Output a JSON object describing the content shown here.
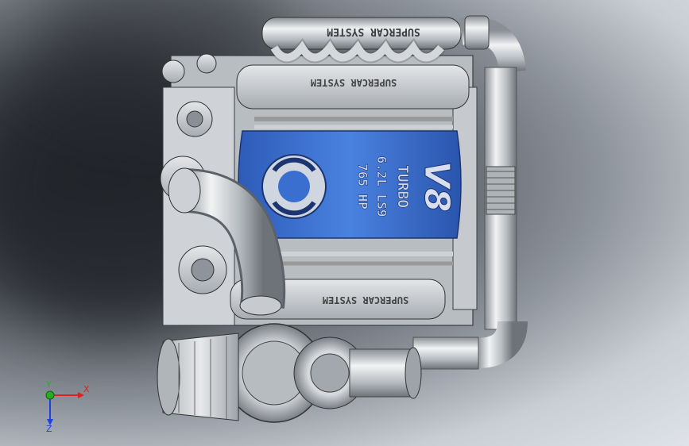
{
  "app": {
    "title": ""
  },
  "model": {
    "manifold_top_text": "SUPERCAR SYSTEM",
    "valve_cover_text": "SUPERCAR SYSTEM",
    "valve_cover_bottom_text": "SUPERCAR SYSTEM",
    "intake_line1": "TURBO",
    "intake_line2": "6.2L LS9",
    "intake_line3": "765 HP",
    "intake_badge": "V8"
  },
  "triad": {
    "x_label": "X",
    "y_label": "Y",
    "z_label": "Z"
  },
  "colors": {
    "accent_blue": "#3a6fd0",
    "metal": "#c8ccd0",
    "x_axis": "#e02020",
    "y_axis": "#20b020",
    "z_axis": "#2040e0"
  }
}
